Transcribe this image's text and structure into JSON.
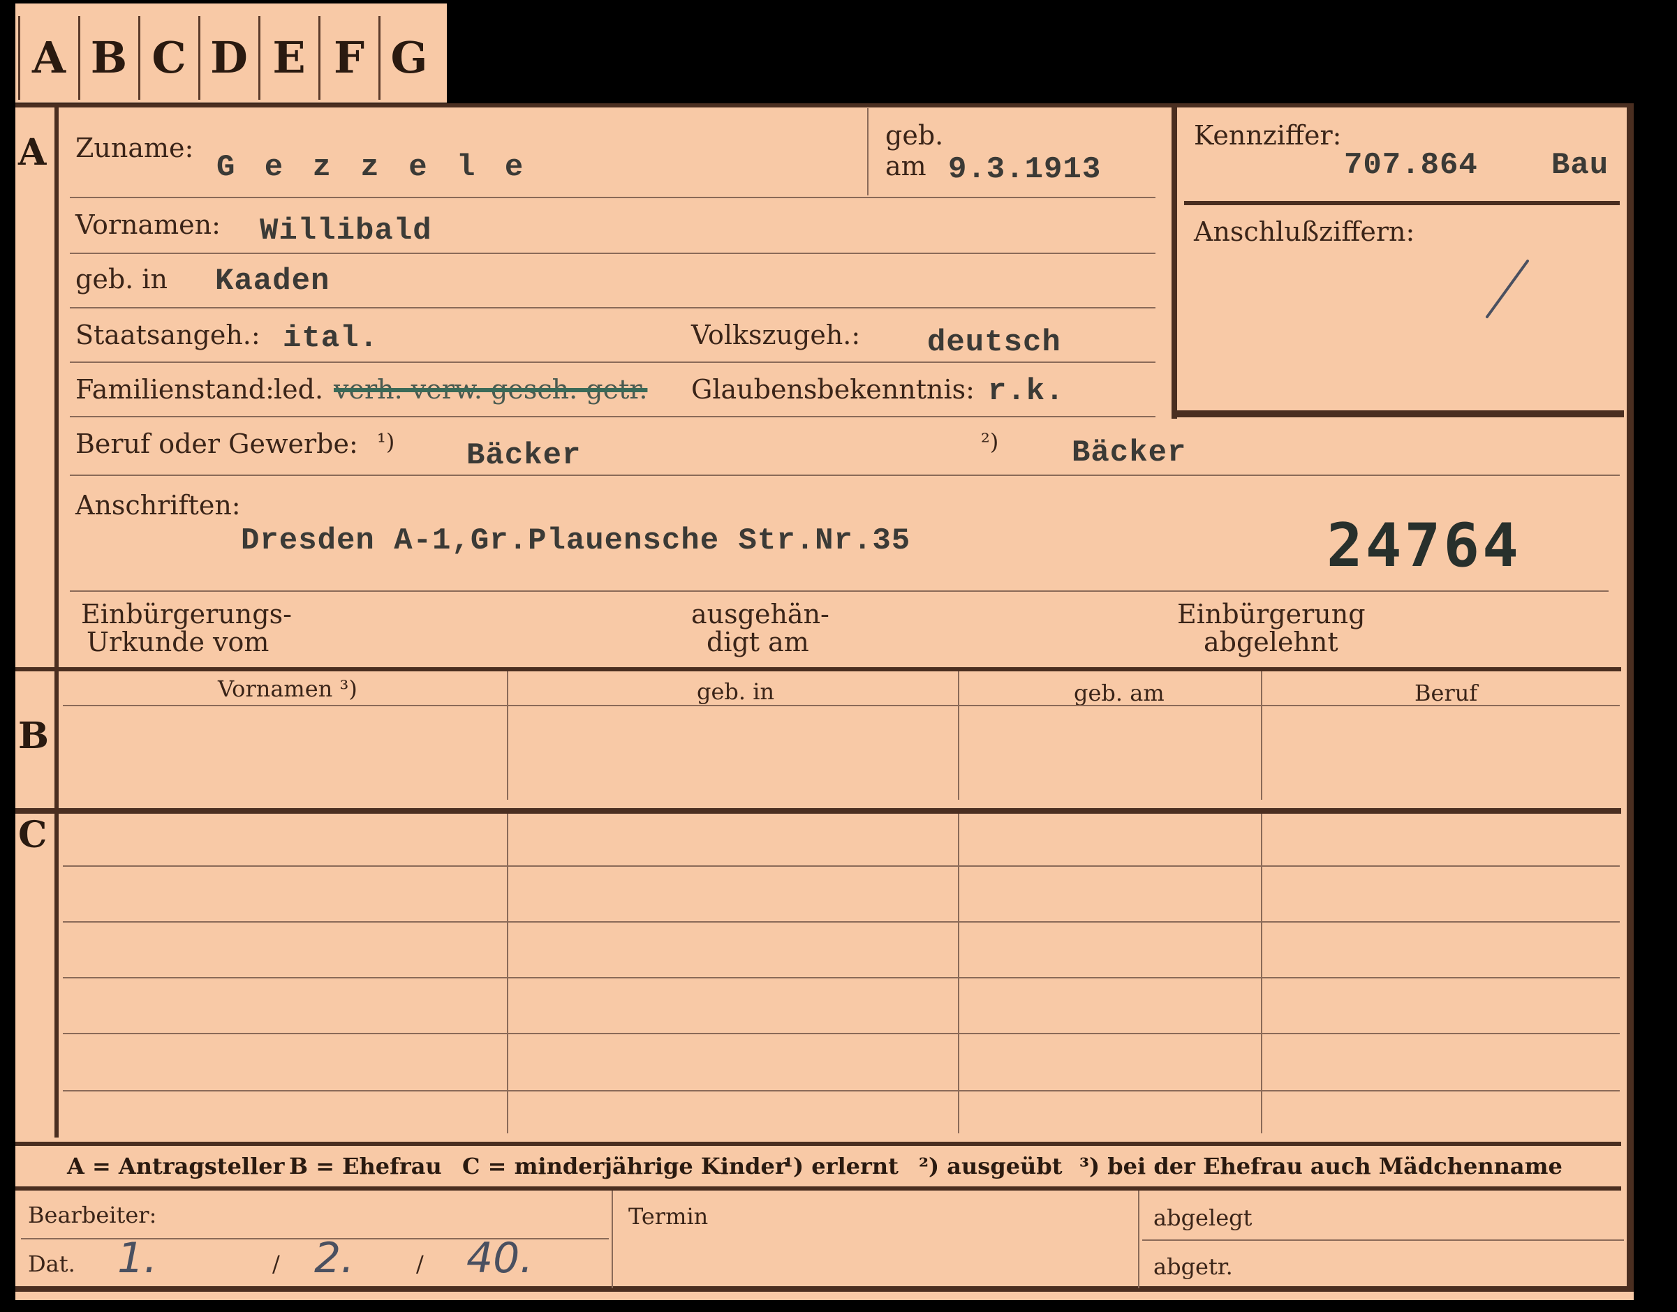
{
  "tabs": [
    "A",
    "B",
    "C",
    "D",
    "E",
    "F",
    "G"
  ],
  "sections": {
    "a": "A",
    "b": "B",
    "c": "C"
  },
  "section_a": {
    "zuname_label": "Zuname:",
    "zuname_value": "G e z z e l e",
    "geb_label": "geb.",
    "am_label": "am",
    "geb_value": "9.3.1913",
    "kennziffer_label": "Kennziffer:",
    "kennziffer_value": "707.864",
    "kennziffer_suffix": "Bau",
    "anschluss_label": "Anschlußziffern:",
    "vornamen_label": "Vornamen:",
    "vornamen_value": "Willibald",
    "gebin_label": "geb. in",
    "gebin_value": "Kaaden",
    "staats_label": "Staatsangeh.:",
    "staats_value": "ital.",
    "volks_label": "Volkszugeh.:",
    "volks_value": "deutsch",
    "familien_label": "Familienstand:",
    "familien_value": "led.",
    "familien_struck": "verh. verw. gesch. getr.",
    "glaubens_label": "Glaubensbekenntnis:",
    "glaubens_value": "r.k.",
    "beruf_label": "Beruf oder Gewerbe:",
    "beruf_mark1": "¹)",
    "beruf_value1": "Bäcker",
    "beruf_mark2": "²)",
    "beruf_value2": "Bäcker",
    "anschriften_label": "Anschriften:",
    "anschriften_value": "Dresden A-1,Gr.Plauensche Str.Nr.35",
    "stamp_number": "24764",
    "einb_label1": "Einbürgerungs-",
    "einb_label2": "Urkunde vom",
    "ausgeh_label1": "ausgehän-",
    "ausgeh_label2": "digt am",
    "abgelehnt_label1": "Einbürgerung",
    "abgelehnt_label2": "abgelehnt"
  },
  "section_b": {
    "columns": [
      "Vornamen ³)",
      "geb. in",
      "geb. am",
      "Beruf"
    ]
  },
  "legend": {
    "a": "A = Antragsteller",
    "b": "B = Ehefrau",
    "c": "C = minderjährige Kinder",
    "n1": "¹) erlernt",
    "n2": "²) ausgeübt",
    "n3": "³) bei der Ehefrau auch Mädchenname"
  },
  "footer": {
    "bearbeiter_label": "Bearbeiter:",
    "dat_label": "Dat.",
    "dat_day": "1.",
    "dat_month": "2.",
    "dat_year": "40.",
    "termin_label": "Termin",
    "abgelegt_label": "abgelegt",
    "abgetr_label": "abgetr."
  }
}
